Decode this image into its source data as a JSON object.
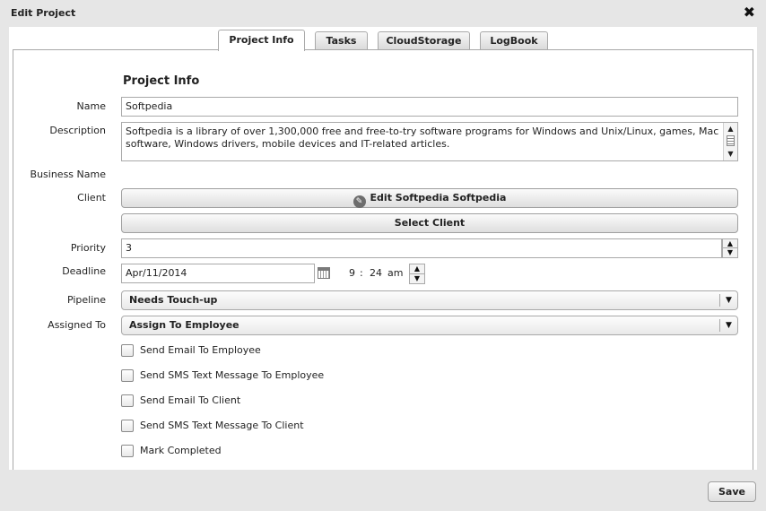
{
  "window": {
    "title": "Edit Project",
    "close_label": "✖"
  },
  "tabs": [
    {
      "label": "Project Info"
    },
    {
      "label": "Tasks"
    },
    {
      "label": "CloudStorage"
    },
    {
      "label": "LogBook"
    }
  ],
  "section_title": "Project Info",
  "labels": {
    "name": "Name",
    "description": "Description",
    "business_name": "Business Name",
    "client": "Client",
    "priority": "Priority",
    "deadline": "Deadline",
    "pipeline": "Pipeline",
    "assigned_to": "Assigned To"
  },
  "fields": {
    "name": "Softpedia",
    "description": "Softpedia is a library of over 1,300,000 free and free-to-try software programs for Windows and Unix/Linux, games, Mac software, Windows drivers, mobile devices and IT-related articles.",
    "priority": "3",
    "deadline_date": "Apr/11/2014",
    "deadline_hour": "9",
    "deadline_sep": ":",
    "deadline_minute": "24",
    "deadline_ampm": "am",
    "pipeline": "Needs Touch-up",
    "assigned_to": "Assign To Employee"
  },
  "buttons": {
    "edit_client": "Edit Softpedia Softpedia",
    "select_client": "Select Client",
    "save": "Save"
  },
  "checkboxes": [
    {
      "label": "Send Email To Employee",
      "checked": false
    },
    {
      "label": "Send SMS Text Message To Employee",
      "checked": false
    },
    {
      "label": "Send Email To Client",
      "checked": false
    },
    {
      "label": "Send SMS Text Message To Client",
      "checked": false
    },
    {
      "label": "Mark Completed",
      "checked": false
    }
  ],
  "icons": {
    "edit": "pencil-icon",
    "calendar": "calendar-icon",
    "close": "close-icon"
  }
}
